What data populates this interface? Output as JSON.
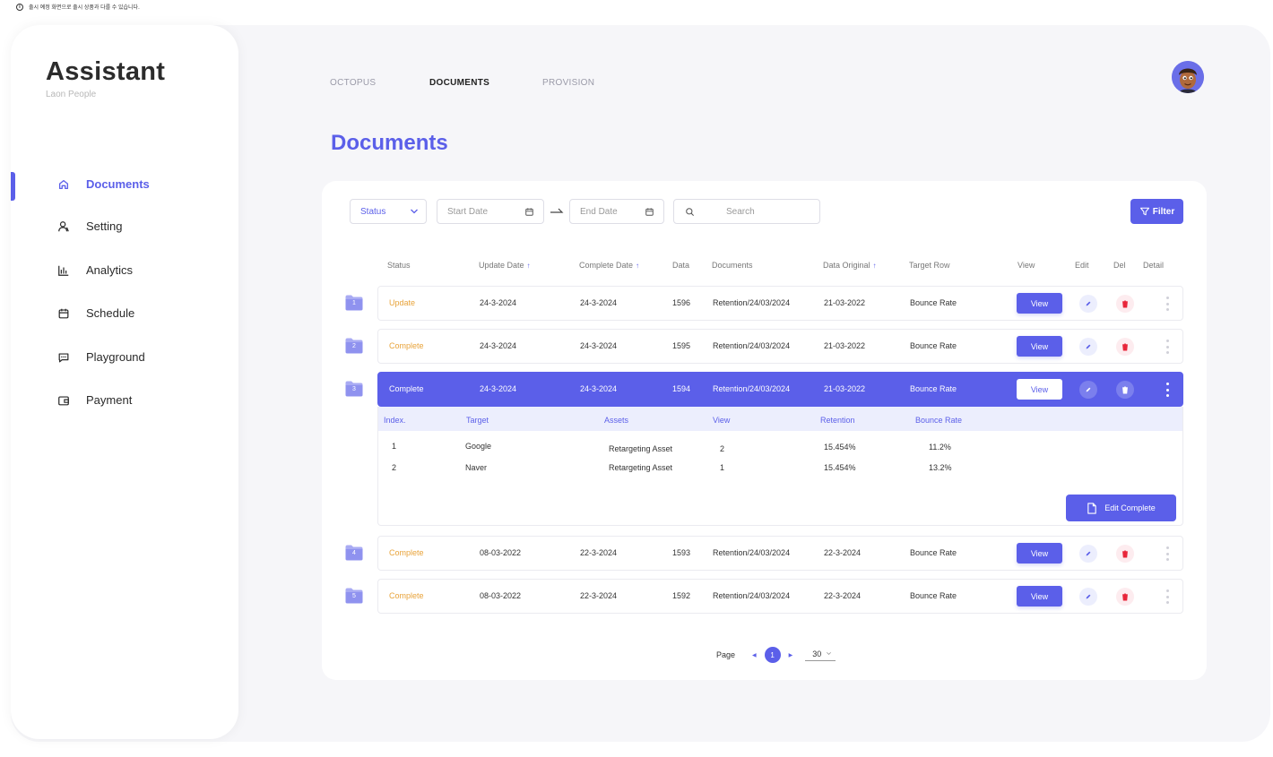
{
  "notice": {
    "icon": "info-icon",
    "text": "출시 예정 화면으로 출시 상품과 다를 수 있습니다."
  },
  "brand": {
    "title": "Assistant",
    "subtitle": "Laon People"
  },
  "sidebar": {
    "items": [
      {
        "label": "Documents",
        "icon": "home-icon",
        "active": true
      },
      {
        "label": "Setting",
        "icon": "user-icon",
        "active": false
      },
      {
        "label": "Analytics",
        "icon": "bar-chart-icon",
        "active": false
      },
      {
        "label": "Schedule",
        "icon": "calendar-icon",
        "active": false
      },
      {
        "label": "Playground",
        "icon": "chat-icon",
        "active": false
      },
      {
        "label": "Payment",
        "icon": "wallet-icon",
        "active": false
      }
    ]
  },
  "top_tabs": [
    {
      "label": "OCTOPUS",
      "active": false
    },
    {
      "label": "DOCUMENTS",
      "active": true
    },
    {
      "label": "PROVISION",
      "active": false
    }
  ],
  "page_title": "Documents",
  "toolbar": {
    "status_label": "Status",
    "start_date_placeholder": "Start Date",
    "end_date_placeholder": "End Date",
    "search_placeholder": "Search",
    "filter_label": "Filter"
  },
  "table": {
    "headers": [
      "Status",
      "Update Date",
      "Complete Date",
      "Data",
      "Documents",
      "Data Original",
      "Target Row",
      "View",
      "Edit",
      "Del",
      "Detail"
    ],
    "sort_arrow": "↑",
    "rows": [
      {
        "index": "1",
        "status": "Update",
        "update_date": "24-3-2024",
        "complete_date": "24-3-2024",
        "data": "1596",
        "documents": "Retention/24/03/2024",
        "data_original": "21-03-2022",
        "target_row": "Bounce Rate",
        "view_label": "View"
      },
      {
        "index": "2",
        "status": "Complete",
        "update_date": "24-3-2024",
        "complete_date": "24-3-2024",
        "data": "1595",
        "documents": "Retention/24/03/2024",
        "data_original": "21-03-2022",
        "target_row": "Bounce Rate",
        "view_label": "View"
      },
      {
        "index": "3",
        "status": "Complete",
        "update_date": "24-3-2024",
        "complete_date": "24-3-2024",
        "data": "1594",
        "documents": "Retention/24/03/2024",
        "data_original": "21-03-2022",
        "target_row": "Bounce Rate",
        "view_label": "View"
      },
      {
        "index": "4",
        "status": "Complete",
        "update_date": "08-03-2022",
        "complete_date": "22-3-2024",
        "data": "1593",
        "documents": "Retention/24/03/2024",
        "data_original": "22-3-2024",
        "target_row": "Bounce Rate",
        "view_label": "View"
      },
      {
        "index": "5",
        "status": "Complete",
        "update_date": "08-03-2022",
        "complete_date": "22-3-2024",
        "data": "1592",
        "documents": "Retention/24/03/2024",
        "data_original": "22-3-2024",
        "target_row": "Bounce Rate",
        "view_label": "View"
      }
    ],
    "selected_row": "3"
  },
  "detail": {
    "headers": [
      "Index.",
      "Target",
      "Assets",
      "View",
      "Retention",
      "Bounce Rate"
    ],
    "rows": [
      {
        "index": "1",
        "target": "Google",
        "assets": "Retargeting Asset",
        "view": "2",
        "retention": "15.454%",
        "bounce_rate": "11.2%"
      },
      {
        "index": "2",
        "target": "Naver",
        "assets": "Retargeting Asset",
        "view": "1",
        "retention": "15.454%",
        "bounce_rate": "13.2%"
      }
    ],
    "edit_complete_label": "Edit Complete"
  },
  "pagination": {
    "label": "Page",
    "current": "1",
    "page_size": "30"
  },
  "colors": {
    "accent": "#5b5fe9",
    "status_update": "#e8a33a",
    "delete": "#e8263a",
    "background": "#f6f6f9"
  }
}
